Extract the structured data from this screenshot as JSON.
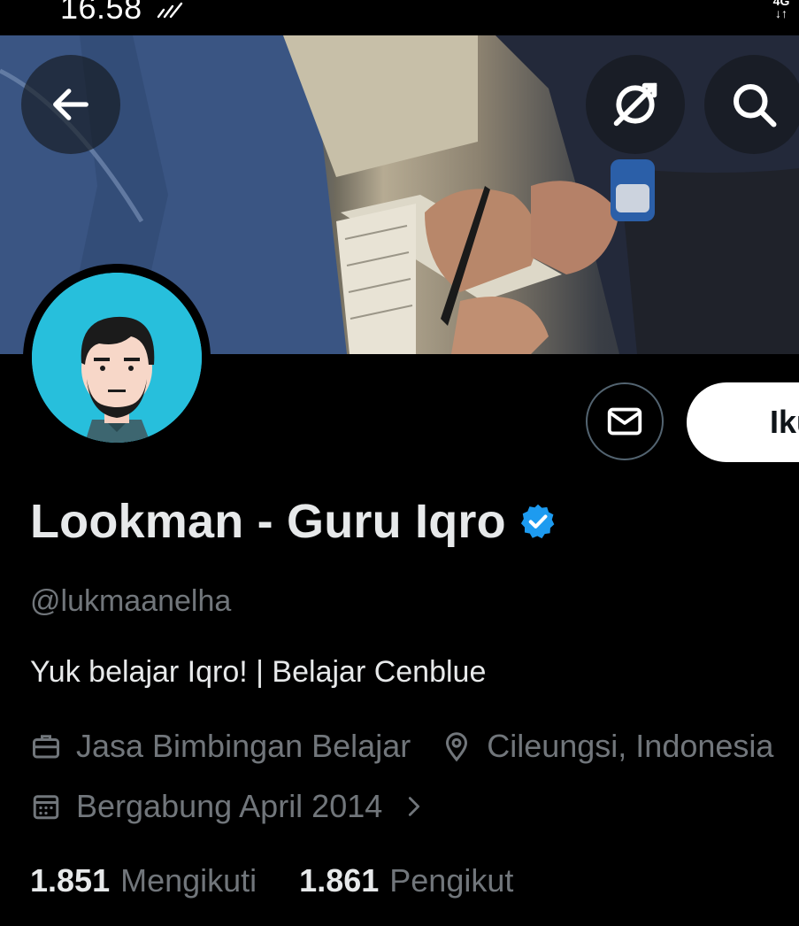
{
  "status_bar": {
    "time": "16.58",
    "network": "4G"
  },
  "header": {
    "back_icon": "arrow-left-icon",
    "translate_icon": "translate-icon",
    "search_icon": "search-icon"
  },
  "profile": {
    "display_name": "Lookman - Guru Iqro",
    "verified": true,
    "handle": "@lukmaanelha",
    "bio": "Yuk belajar Iqro! | Belajar Cenblue",
    "category": "Jasa Bimbingan Belajar",
    "location": "Cileungsi, Indonesia",
    "joined": "Bergabung April 2014",
    "following_count": "1.851",
    "following_label": "Mengikuti",
    "followers_count": "1.861",
    "followers_label": "Pengikut"
  },
  "actions": {
    "follow_label": "Ikuti"
  },
  "colors": {
    "background": "#000000",
    "text_primary": "#e7e9ea",
    "text_secondary": "#71767b",
    "verified_blue": "#1d9bf0",
    "avatar_bg": "#27bfdc"
  }
}
